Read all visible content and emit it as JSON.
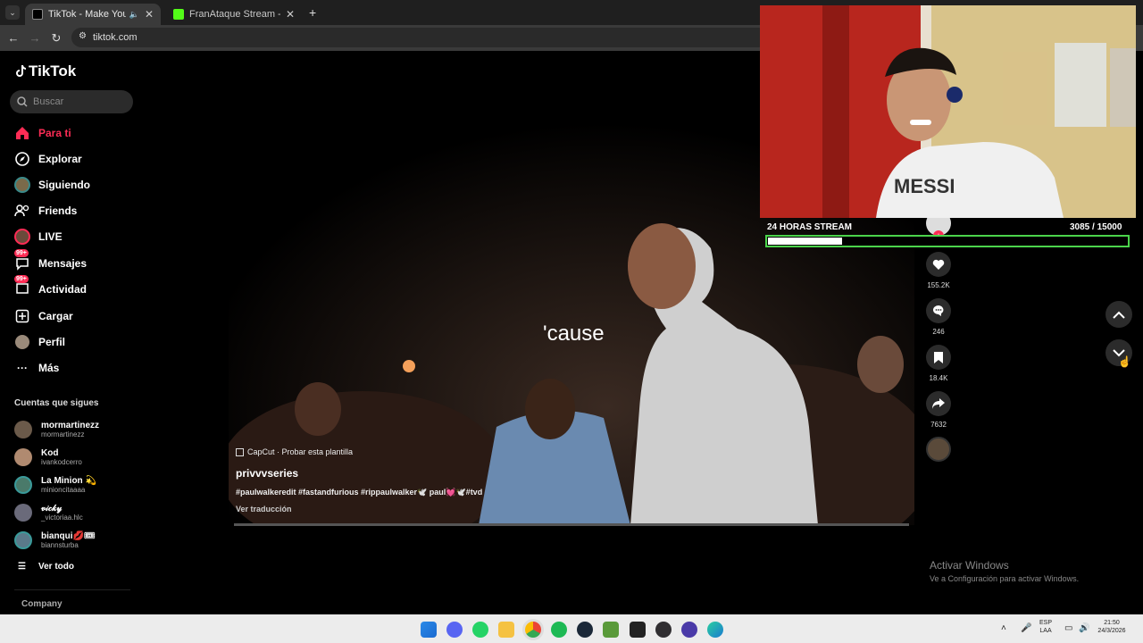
{
  "browser": {
    "tabs": [
      {
        "title": "TikTok - Make Your Day",
        "active": true
      },
      {
        "title": "FranAtaque Stream - Watch Live",
        "active": false
      }
    ],
    "new_tab": "+",
    "url": "tiktok.com"
  },
  "sidebar": {
    "logo": "TikTok",
    "search_placeholder": "Buscar",
    "nav": [
      {
        "label": "Para ti",
        "icon": "home-icon",
        "active": true
      },
      {
        "label": "Explorar",
        "icon": "compass-icon"
      },
      {
        "label": "Siguiendo",
        "icon": "following-avatar-icon"
      },
      {
        "label": "Friends",
        "icon": "friends-icon"
      },
      {
        "label": "LIVE",
        "icon": "live-icon"
      },
      {
        "label": "Mensajes",
        "icon": "messages-icon",
        "badge": "99+"
      },
      {
        "label": "Actividad",
        "icon": "activity-icon",
        "badge": "99+"
      },
      {
        "label": "Cargar",
        "icon": "upload-icon"
      },
      {
        "label": "Perfil",
        "icon": "profile-icon"
      },
      {
        "label": "Más",
        "icon": "more-icon"
      }
    ],
    "following_title": "Cuentas que sigues",
    "accounts": [
      {
        "name": "mormartinezz",
        "handle": "mormartinezz",
        "color": "#6b5a4a"
      },
      {
        "name": "Kod",
        "handle": "ivankodcerro",
        "color": "#b08a70"
      },
      {
        "name": "La Minion 💫",
        "handle": "minioncitaaaa",
        "color": "#4a7a6a"
      },
      {
        "name": "𝓋𝒾𝒸𝓀𝓎",
        "handle": "_victoriaa.hlc",
        "color": "#6a6a7a"
      },
      {
        "name": "bianqui💋🎟",
        "handle": "biannsturba",
        "color": "#5a7a8a"
      }
    ],
    "see_all": "Ver todo",
    "company": "Company"
  },
  "video": {
    "caption": "'cause",
    "capcut": "CapCut · Probar esta plantilla",
    "author": "privvvseries",
    "tags": "#paulwalkeredit #fastandfurious #rippaulwalker🕊️ paul💓🕊️#tvd",
    "translate": "Ver traducción",
    "actions": [
      {
        "icon": "heart-icon",
        "count": "155.2K"
      },
      {
        "icon": "comment-icon",
        "count": "246"
      },
      {
        "icon": "bookmark-icon",
        "count": "18.4K"
      },
      {
        "icon": "share-icon",
        "count": "7632"
      }
    ]
  },
  "stream_overlay": {
    "title": "24 HORAS STREAM",
    "counter": "3085",
    "goal": "/ 15000",
    "progress": 0.2057
  },
  "watermark": {
    "line1": "Activar Windows",
    "line2": "Ve a Configuración para activar Windows."
  },
  "taskbar": {
    "lang1": "ESP",
    "lang2": "LAA",
    "time": "21:50",
    "date": "24/3/2026"
  }
}
